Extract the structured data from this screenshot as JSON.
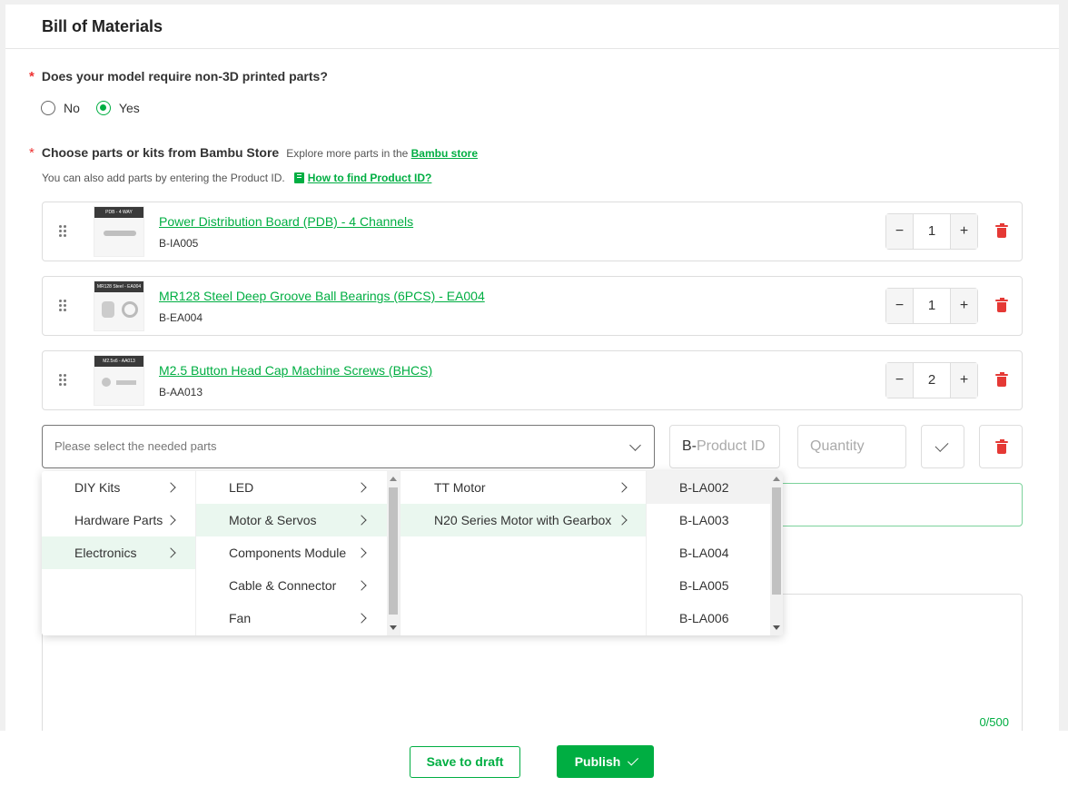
{
  "section": {
    "title": "Bill of Materials"
  },
  "question1": {
    "required_mark": "*",
    "text": "Does your model require non-3D printed parts?",
    "options": [
      {
        "label": "No",
        "selected": false
      },
      {
        "label": "Yes",
        "selected": true
      }
    ]
  },
  "question2": {
    "required_mark": "*",
    "text": "Choose parts or kits from Bambu Store",
    "explore_text": "Explore more parts in the",
    "store_link": "Bambu store",
    "hint_text": "You can also add parts by entering the Product ID.",
    "how_link": "How to find Product ID?"
  },
  "parts": [
    {
      "name": "Power Distribution Board (PDB) - 4 Channels",
      "sku": "B-IA005",
      "quantity": "1",
      "thumb_label": "PDB - 4 WAY"
    },
    {
      "name": "MR128 Steel Deep Groove Ball Bearings (6PCS) - EA004",
      "sku": "B-EA004",
      "quantity": "1",
      "thumb_label": "MR128 Steel - EA004"
    },
    {
      "name": "M2.5 Button Head Cap Machine Screws (BHCS)",
      "sku": "B-AA013",
      "quantity": "2",
      "thumb_label": "M2.5x6 - AA013"
    }
  ],
  "stepper": {
    "minus": "−",
    "plus": "+"
  },
  "new_part": {
    "select_placeholder": "Please select the needed parts",
    "product_id_prefix": "B-",
    "product_id_placeholder": "Product ID",
    "quantity_placeholder": "Quantity"
  },
  "cascade": {
    "col1": [
      "DIY Kits",
      "Hardware Parts",
      "Electronics"
    ],
    "col2": [
      "LED",
      "Motor & Servos",
      "Components Module",
      "Cable & Connector",
      "Fan"
    ],
    "col3": [
      "TT Motor",
      "N20 Series Motor with Gearbox"
    ],
    "col4": [
      "B-LA002",
      "B-LA003",
      "B-LA004",
      "B-LA005",
      "B-LA006"
    ]
  },
  "description": {
    "counter": "0/500"
  },
  "footer": {
    "save_draft": "Save to draft",
    "publish": "Publish"
  },
  "colors": {
    "accent": "#00ae42",
    "danger": "#e53935"
  }
}
